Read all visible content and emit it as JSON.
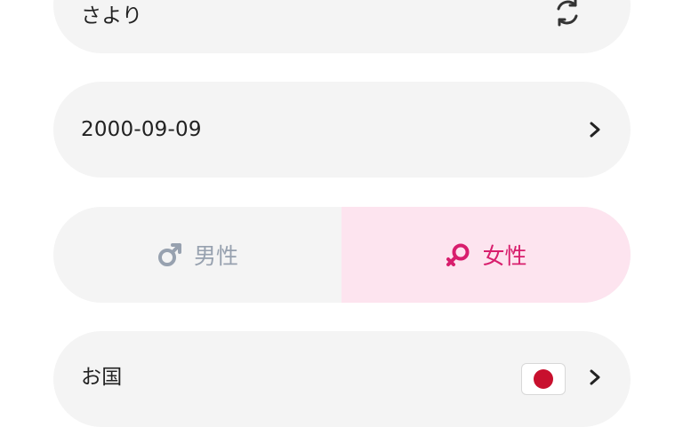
{
  "name_field": {
    "value": "さより"
  },
  "birthday_field": {
    "value": "2000-09-09"
  },
  "gender": {
    "male_label": "男性",
    "female_label": "女性",
    "selected": "female"
  },
  "country_field": {
    "label": "お国",
    "flag": "japan-flag"
  },
  "icons": {
    "refresh": "refresh-icon",
    "chevron": "chevron-right-icon",
    "male": "male-symbol-icon",
    "female": "female-symbol-icon"
  },
  "colors": {
    "field_bg": "#f4f4f4",
    "male_text": "#97a1af",
    "female_text": "#d81e6d",
    "female_bg": "#fde4ef",
    "flag_red": "#c8102e"
  }
}
